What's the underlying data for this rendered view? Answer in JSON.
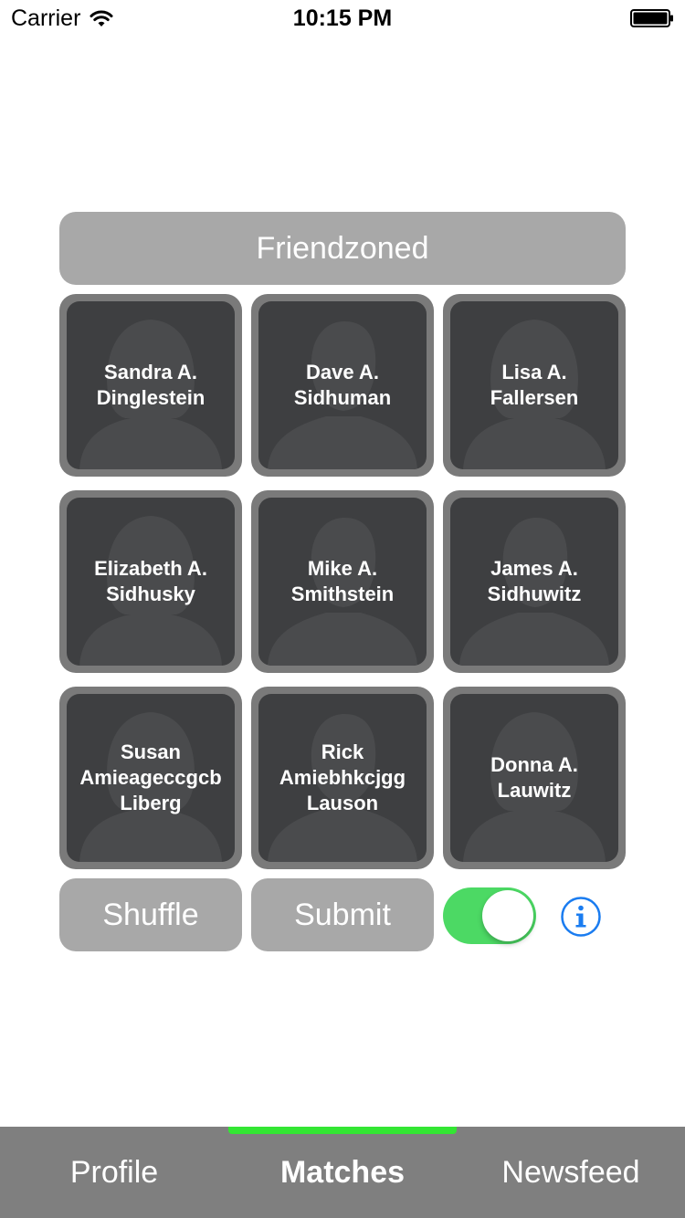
{
  "status_bar": {
    "carrier": "Carrier",
    "time": "10:15 PM"
  },
  "header": {
    "title": "Friendzoned"
  },
  "matches": [
    {
      "name": "Sandra A.\nDinglestein",
      "silhouette": "female"
    },
    {
      "name": "Dave A.\nSidhuman",
      "silhouette": "male"
    },
    {
      "name": "Lisa A.\nFallersen",
      "silhouette": "female"
    },
    {
      "name": "Elizabeth A.\nSidhusky",
      "silhouette": "female"
    },
    {
      "name": "Mike A.\nSmithstein",
      "silhouette": "male"
    },
    {
      "name": "James A.\nSidhuwitz",
      "silhouette": "male"
    },
    {
      "name": "Susan\nAmieageccgcb\nLiberg",
      "silhouette": "female"
    },
    {
      "name": "Rick\nAmiebhkcjgg\nLauson",
      "silhouette": "male"
    },
    {
      "name": "Donna A.\nLauwitz",
      "silhouette": "female"
    }
  ],
  "controls": {
    "shuffle_label": "Shuffle",
    "submit_label": "Submit",
    "toggle_on": true,
    "toggle_color": "#4cd964",
    "info_icon": "info-icon",
    "info_color": "#1a7cf0"
  },
  "tab_bar": {
    "tabs": [
      {
        "label": "Profile",
        "active": false
      },
      {
        "label": "Matches",
        "active": true
      },
      {
        "label": "Newsfeed",
        "active": false
      }
    ],
    "indicator_color": "#33e633"
  }
}
